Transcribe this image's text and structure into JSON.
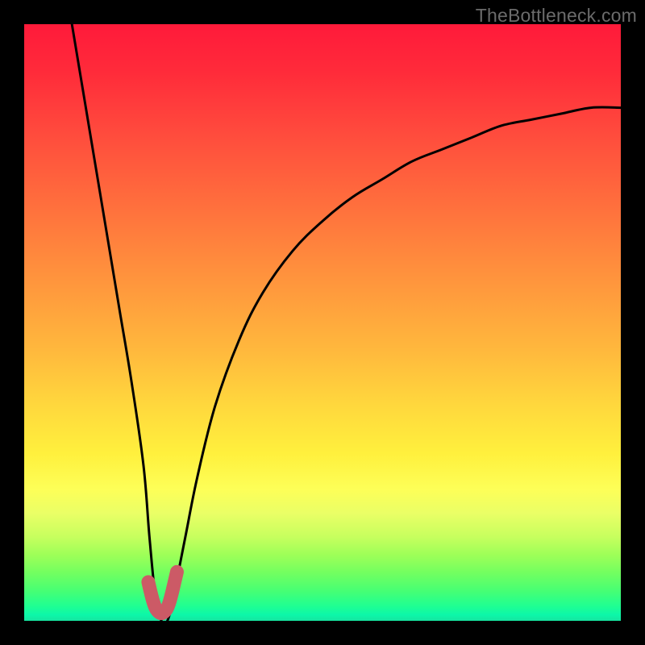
{
  "watermark": "TheBottleneck.com",
  "chart_data": {
    "type": "line",
    "title": "",
    "xlabel": "",
    "ylabel": "",
    "xlim": [
      0,
      100
    ],
    "ylim": [
      0,
      100
    ],
    "grid": false,
    "legend": false,
    "background": {
      "orientation": "vertical",
      "description": "Red at top fading through orange and yellow to green at bottom"
    },
    "series": [
      {
        "name": "bottleneck-curve",
        "color": "#000000",
        "x": [
          8,
          10,
          12,
          14,
          16,
          18,
          20,
          21,
          22,
          23,
          24,
          25,
          27,
          29,
          32,
          36,
          40,
          45,
          50,
          55,
          60,
          65,
          70,
          75,
          80,
          85,
          90,
          95,
          100
        ],
        "y": [
          100,
          88,
          76,
          64,
          52,
          40,
          26,
          14,
          4,
          0,
          0,
          4,
          14,
          24,
          36,
          47,
          55,
          62,
          67,
          71,
          74,
          77,
          79,
          81,
          83,
          84,
          85,
          86,
          86
        ]
      },
      {
        "name": "optimal-marker",
        "color": "#cc5a66",
        "x": [
          20.8,
          21.2,
          21.6,
          22.0,
          22.4,
          22.8,
          23.2,
          23.6,
          24.0,
          24.4,
          24.8,
          25.2,
          25.6
        ],
        "y": [
          6.5,
          4.8,
          3.3,
          2.2,
          1.6,
          1.3,
          1.3,
          1.6,
          2.2,
          3.3,
          4.8,
          6.5,
          8.2
        ]
      }
    ]
  }
}
